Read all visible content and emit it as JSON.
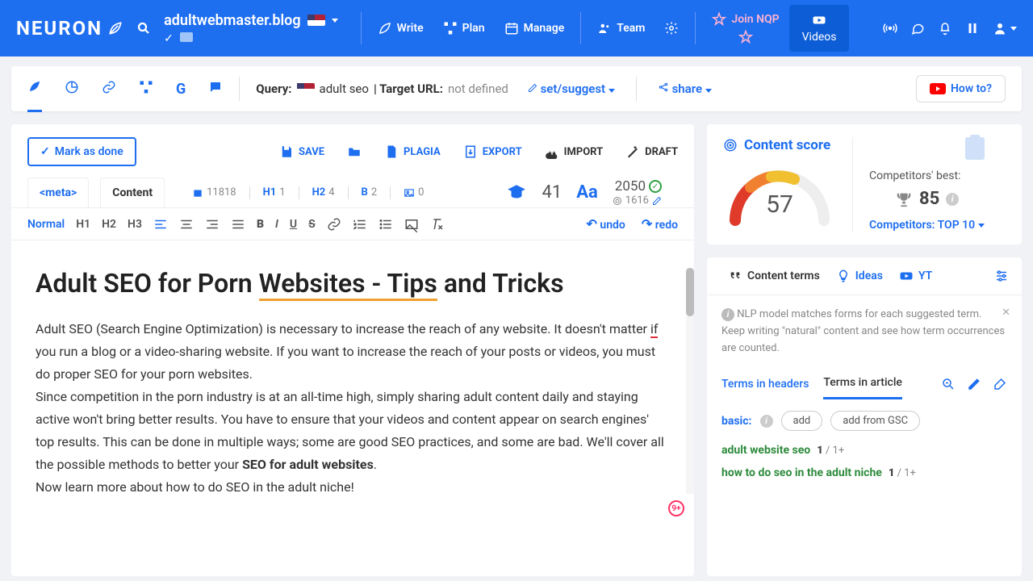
{
  "topbar": {
    "logo": "NEURON",
    "domain": "adultwebmaster.blog",
    "nav": {
      "write": "Write",
      "plan": "Plan",
      "manage": "Manage",
      "team": "Team",
      "join": "Join NQP",
      "videos": "Videos"
    }
  },
  "secondbar": {
    "query_label": "Query:",
    "query": "adult seo",
    "target_label": "| Target URL:",
    "target_value": "not defined",
    "set_suggest": "set/suggest",
    "share": "share",
    "howto": "How to?"
  },
  "editor": {
    "mark_done": "Mark as done",
    "save": "SAVE",
    "plagia": "PLAGIA",
    "export": "EXPORT",
    "import": "IMPORT",
    "draft": "DRAFT",
    "tab_meta": "<meta>",
    "tab_content": "Content",
    "chars": "11818",
    "h1_label": "H1",
    "h1_count": "1",
    "h2_label": "H2",
    "h2_count": "4",
    "b_label": "B",
    "b_count": "2",
    "img_count": "0",
    "readability": "41",
    "words": "2050",
    "words_target": "1616",
    "toolbar": {
      "normal": "Normal",
      "h1": "H1",
      "h2": "H2",
      "h3": "H3",
      "undo": "undo",
      "redo": "redo"
    },
    "article": {
      "title_a": "Adult SEO for Porn ",
      "title_b": "Websites - Tips",
      "title_c": " and Tricks",
      "p1a": "Adult SEO (Search Engine Optimization) is necessary to increase the reach of any website. It doesn't matter ",
      "p1_if": "if ",
      "p1b": "you run a blog or a video-sharing website. If you want to increase the reach of your posts or videos, you must do proper SEO for your porn websites.",
      "p2a": "Since competition in the porn industry is at an all-time high, simply sharing adult content daily and staying active won't bring better results. You have to ensure that your videos and content appear on search engines' top results. This can be done in multiple ways; some are good SEO practices, and some are bad. We'll cover all the possible methods to better your ",
      "p2b": "SEO for adult websites",
      "p2c": ".",
      "p3": "Now learn more about how to do SEO in the adult niche!"
    },
    "badge": "9+"
  },
  "score": {
    "title": "Content score",
    "value": "57",
    "comp_best_label": "Competitors' best:",
    "comp_best": "85",
    "comp_link": "Competitors: TOP 10"
  },
  "terms": {
    "tabs": {
      "content_terms": "Content terms",
      "ideas": "Ideas",
      "yt": "YT"
    },
    "note": "NLP model matches forms for each suggested term. Keep writing \"natural\" content and see how term occurrences are counted.",
    "inner_tabs": {
      "headers": "Terms in headers",
      "article": "Terms in article"
    },
    "basic_label": "basic:",
    "add": "add",
    "add_gsc": "add from GSC",
    "rows": [
      {
        "name": "adult website seo",
        "count": "1",
        "target": "/ 1+"
      },
      {
        "name": "how to do seo in the adult niche",
        "count": "1",
        "target": "/ 1+"
      }
    ]
  }
}
